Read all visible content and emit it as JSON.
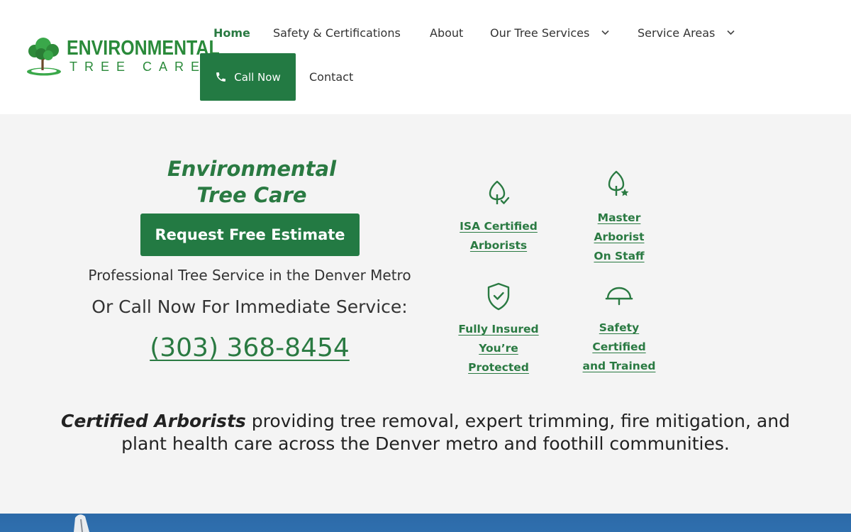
{
  "header": {
    "logo": {
      "line1": "ENVIRONMENTAL",
      "line2": "TREE CARE"
    },
    "nav": {
      "home": "Home",
      "safety": "Safety & Certifications",
      "about": "About",
      "services": "Our Tree Services",
      "areas": "Service Areas",
      "call_now": "Call Now",
      "contact": "Contact"
    }
  },
  "hero": {
    "brand_line1": "Environmental",
    "brand_line2": "Tree Care",
    "estimate_button": "Request Free Estimate",
    "tagline": "Professional Tree Service in the Denver Metro",
    "call_prompt": "Or Call Now For Immediate Service:",
    "phone": "(303) 368-8454"
  },
  "features": [
    {
      "lines": [
        "ISA Certified",
        "Arborists"
      ],
      "icon": "leaf-check-icon"
    },
    {
      "lines": [
        "Master",
        "Arborist",
        "On Staff"
      ],
      "icon": "leaf-star-icon"
    },
    {
      "lines": [
        "Fully Insured",
        "You’re",
        "Protected"
      ],
      "icon": "shield-check-icon"
    },
    {
      "lines": [
        "Safety",
        "Certified",
        "and Trained"
      ],
      "icon": "hard-hat-icon"
    }
  ],
  "description": {
    "emphasis": "Certified Arborists",
    "text": " providing tree removal, expert trimming, fire mitigation, and plant health care across the Denver metro and foothill communities."
  },
  "colors": {
    "brand_green": "#237a43",
    "link_green": "#2a7a42",
    "background": "#f4f4f4",
    "band_blue": "#2c6aa8"
  }
}
